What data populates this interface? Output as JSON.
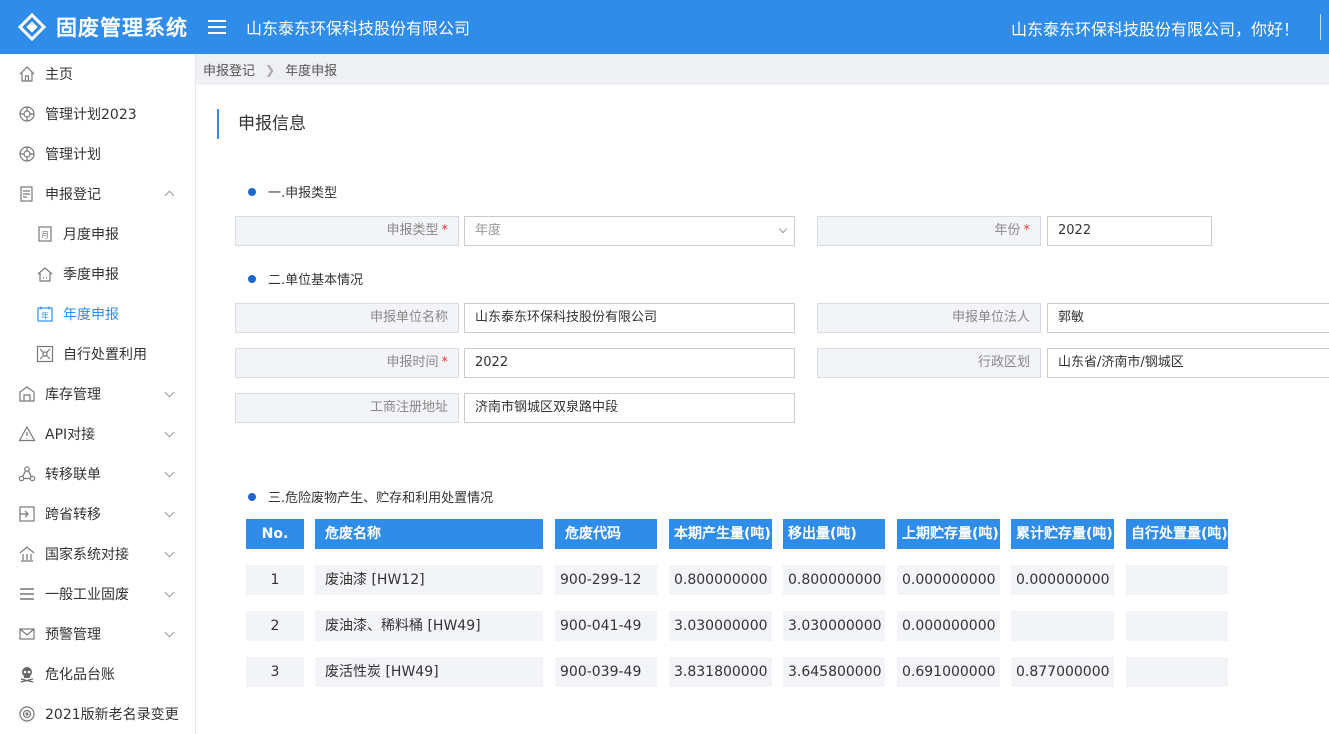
{
  "header": {
    "app_title": "固废管理系统",
    "company": "山东泰东环保科技股份有限公司",
    "greeting": "山东泰东环保科技股份有限公司，你好！"
  },
  "sidebar": {
    "items": [
      {
        "label": "主页",
        "icon": "home-icon"
      },
      {
        "label": "管理计划2023",
        "icon": "plan-icon"
      },
      {
        "label": "管理计划",
        "icon": "plan-icon"
      },
      {
        "label": "申报登记",
        "icon": "document-icon",
        "expanded": true
      },
      {
        "label": "月度申报",
        "icon": "month-icon"
      },
      {
        "label": "季度申报",
        "icon": "quarter-icon"
      },
      {
        "label": "年度申报",
        "icon": "year-icon",
        "active": true
      },
      {
        "label": "自行处置利用",
        "icon": "network-icon"
      },
      {
        "label": "库存管理",
        "icon": "warehouse-icon"
      },
      {
        "label": "API对接",
        "icon": "api-icon"
      },
      {
        "label": "转移联单",
        "icon": "transfer-icon"
      },
      {
        "label": "跨省转移",
        "icon": "cross-province-icon"
      },
      {
        "label": "国家系统对接",
        "icon": "building-icon"
      },
      {
        "label": "一般工业固废",
        "icon": "list-icon"
      },
      {
        "label": "预警管理",
        "icon": "mail-icon"
      },
      {
        "label": "危化品台账",
        "icon": "skull-icon"
      },
      {
        "label": "2021版新老名录变更",
        "icon": "settings-icon"
      }
    ]
  },
  "breadcrumb": {
    "items": [
      "申报登记",
      "年度申报"
    ]
  },
  "main": {
    "title": "申报信息",
    "section1": {
      "heading": "一.申报类型",
      "type_label": "申报类型",
      "type_value": "年度",
      "year_label": "年份",
      "year_value": "2022"
    },
    "section2": {
      "heading": "二.单位基本情况",
      "name_label": "申报单位名称",
      "name_value": "山东泰东环保科技股份有限公司",
      "legal_label": "申报单位法人",
      "legal_value": "郭敏",
      "time_label": "申报时间",
      "time_value": "2022",
      "region_label": "行政区划",
      "region_value": "山东省/济南市/钢城区",
      "address_label": "工商注册地址",
      "address_value": "济南市钢城区双泉路中段"
    },
    "section3": {
      "heading": "三.危险废物产生、贮存和利用处置情况",
      "columns": [
        "No.",
        "危废名称",
        "危废代码",
        "本期产生量(吨)",
        "移出量(吨)",
        "上期贮存量(吨)",
        "累计贮存量(吨)",
        "自行处置量(吨)"
      ],
      "rows": [
        [
          "1",
          "废油漆 [HW12]",
          "900-299-12",
          "0.800000000",
          "0.800000000",
          "0.000000000",
          "0.000000000",
          ""
        ],
        [
          "2",
          "废油漆、稀料桶 [HW49]",
          "900-041-49",
          "3.030000000",
          "3.030000000",
          "0.000000000",
          "",
          ""
        ],
        [
          "3",
          "废活性炭 [HW49]",
          "900-039-49",
          "3.831800000",
          "3.645800000",
          "0.691000000",
          "0.877000000",
          ""
        ]
      ]
    }
  },
  "colors": {
    "primary": "#2f8ce8",
    "required": "#e4393c",
    "dot": "#1e66d0"
  }
}
